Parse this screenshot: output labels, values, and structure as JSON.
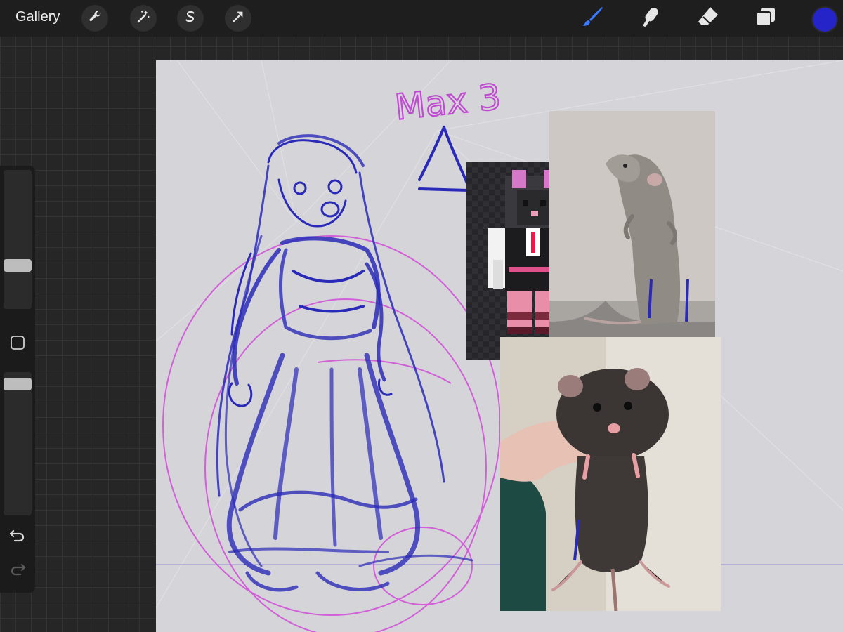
{
  "toolbar": {
    "gallery_label": "Gallery",
    "left_tools": [
      "wrench-icon",
      "magic-wand-icon",
      "selection-s-icon",
      "arrow-transform-icon"
    ],
    "right_tools": [
      "brush-icon",
      "smudge-icon",
      "eraser-icon",
      "layers-icon"
    ],
    "active_tool": "brush-icon",
    "active_tool_color": "#3b7bff",
    "current_color": "#2424c8"
  },
  "sidebar": {
    "controls": [
      "brush-size-slider",
      "modify-button",
      "opacity-slider",
      "undo-icon",
      "redo-icon"
    ]
  },
  "canvas": {
    "handwritten_label": "Max 3",
    "label_color": "#c04ad2",
    "ink_color": "#2a2ab8",
    "guide_color": "#d03ad8",
    "reference_images": [
      "minecraft-skin-rat-maid",
      "grey-rat-standing",
      "dark-rat-held-in-hand"
    ]
  }
}
